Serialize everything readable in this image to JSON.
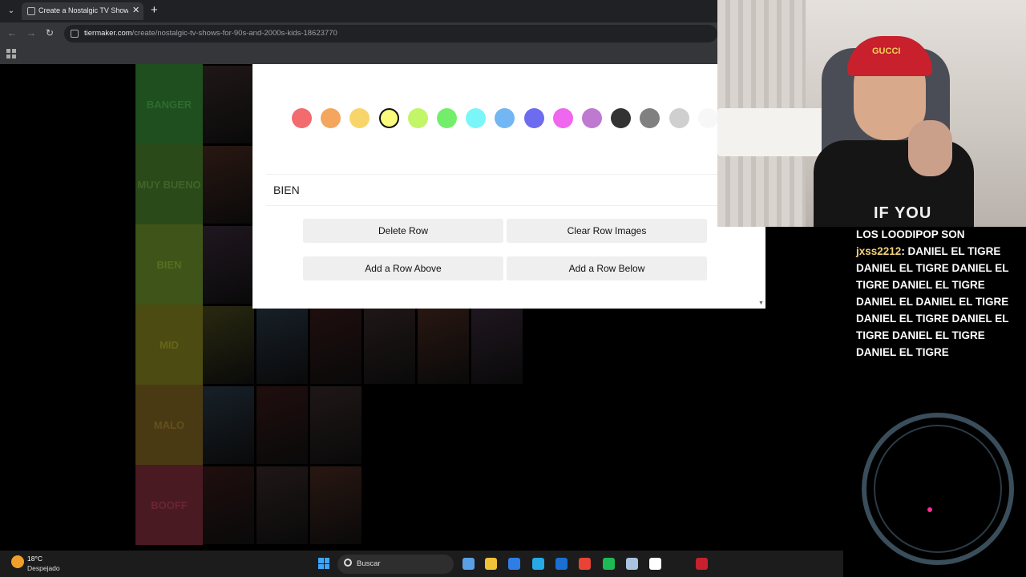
{
  "browser": {
    "tab_title": "Create a Nostalgic TV Shows fo",
    "tab_close": "✕",
    "new_tab": "+",
    "url_host": "tiermaker.com",
    "url_path": "/create/nostalgic-tv-shows-for-90s-and-2000s-kids-18623770"
  },
  "tiers": [
    {
      "label": "BANGER",
      "color": "#1f4f1f",
      "text_color": "#2f6a2f"
    },
    {
      "label": "MUY BUENO",
      "color": "#2b4a1a",
      "text_color": "#3f6526"
    },
    {
      "label": "BIEN",
      "color": "#3f5418",
      "text_color": "#566f22"
    },
    {
      "label": "MID",
      "color": "#4c4b12",
      "text_color": "#67661a"
    },
    {
      "label": "MALO",
      "color": "#4a3a14",
      "text_color": "#64501c"
    },
    {
      "label": "BOOFF",
      "color": "#4a1a22",
      "text_color": "#6a2630"
    }
  ],
  "modal": {
    "swatches": [
      "#f26b6f",
      "#f5a65e",
      "#f7d56a",
      "#fafb7d",
      "#c2f568",
      "#73ee6a",
      "#7af6f8",
      "#72b6f3",
      "#6d6cf0",
      "#ef66ef",
      "#be79d0",
      "#333333",
      "#808080",
      "#cfcfcf",
      "#f7f7f7"
    ],
    "selected_swatch": 3,
    "row_label": "BIEN",
    "delete_row": "Delete Row",
    "clear_row_images": "Clear Row Images",
    "add_row_above": "Add a Row Above",
    "add_row_below": "Add a Row Below"
  },
  "webcam": {
    "cap_text": "GUCCI",
    "shirt_text": "IF YOU"
  },
  "chat": {
    "line1": "LOS LOODIPOP SON",
    "user": "jxss2212",
    "message": ": DANIEL EL TIGRE DANIEL EL TIGRE DANIEL EL TIGRE DANIEL EL TIGRE DANIEL EL DANIEL EL TIGRE DANIEL EL TIGRE DANIEL EL TIGRE DANIEL EL TIGRE DANIEL EL TIGRE"
  },
  "taskbar": {
    "temperature": "18°C",
    "weather": "Despejado",
    "search_label": "Buscar",
    "app_colors": [
      "#5aa0e6",
      "#f0c23a",
      "#2f7ee6",
      "#27a9e6",
      "#1a6fd1",
      "#ea4335",
      "#1db954",
      "#a9c2df",
      "#ffffff",
      "#c8202c"
    ]
  }
}
